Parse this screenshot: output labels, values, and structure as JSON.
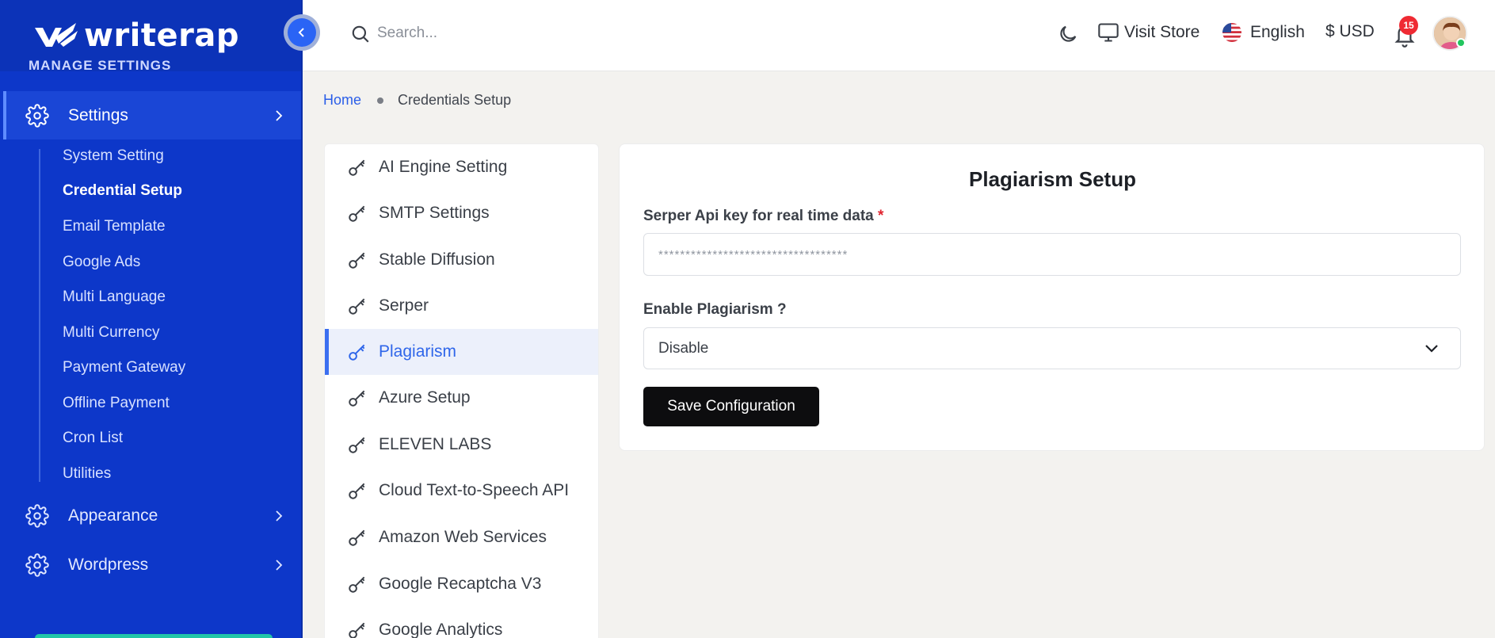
{
  "brand": {
    "name": "writerap"
  },
  "sidebar": {
    "section_label": "MANAGE SETTINGS",
    "settings": {
      "label": "Settings",
      "icon": "gear-icon"
    },
    "sub_items": [
      {
        "label": "System Setting"
      },
      {
        "label": "Credential Setup"
      },
      {
        "label": "Email Template"
      },
      {
        "label": "Google Ads"
      },
      {
        "label": "Multi Language"
      },
      {
        "label": "Multi Currency"
      },
      {
        "label": "Payment Gateway"
      },
      {
        "label": "Offline Payment"
      },
      {
        "label": "Cron List"
      },
      {
        "label": "Utilities"
      }
    ],
    "appearance": {
      "label": "Appearance",
      "icon": "gear-icon"
    },
    "wordpress": {
      "label": "Wordpress",
      "icon": "gear-icon"
    }
  },
  "topbar": {
    "search_placeholder": "Search...",
    "visit_store": "Visit Store",
    "language": "English",
    "currency": "$ USD",
    "notification_count": "15"
  },
  "breadcrumb": {
    "home": "Home",
    "current": "Credentials Setup"
  },
  "credential_menu": [
    {
      "label": "AI Engine Setting"
    },
    {
      "label": "SMTP Settings"
    },
    {
      "label": "Stable Diffusion"
    },
    {
      "label": "Serper"
    },
    {
      "label": "Plagiarism"
    },
    {
      "label": "Azure Setup"
    },
    {
      "label": "ELEVEN LABS"
    },
    {
      "label": "Cloud Text-to-Speech API"
    },
    {
      "label": "Amazon Web Services"
    },
    {
      "label": "Google Recaptcha V3"
    },
    {
      "label": "Google Analytics"
    }
  ],
  "form": {
    "title": "Plagiarism Setup",
    "api_key_label": "Serper Api key for real time data",
    "required_mark": "*",
    "api_key_value": "***********************************",
    "enable_label": "Enable Plagiarism ?",
    "enable_value": "Disable",
    "save_label": "Save Configuration"
  },
  "colors": {
    "sidebar_bg": "#0d37c9",
    "accent": "#2f66ea",
    "active_bg": "#ecf0fb",
    "button_bg": "#0d0d0f",
    "badge": "#ef2a33"
  }
}
